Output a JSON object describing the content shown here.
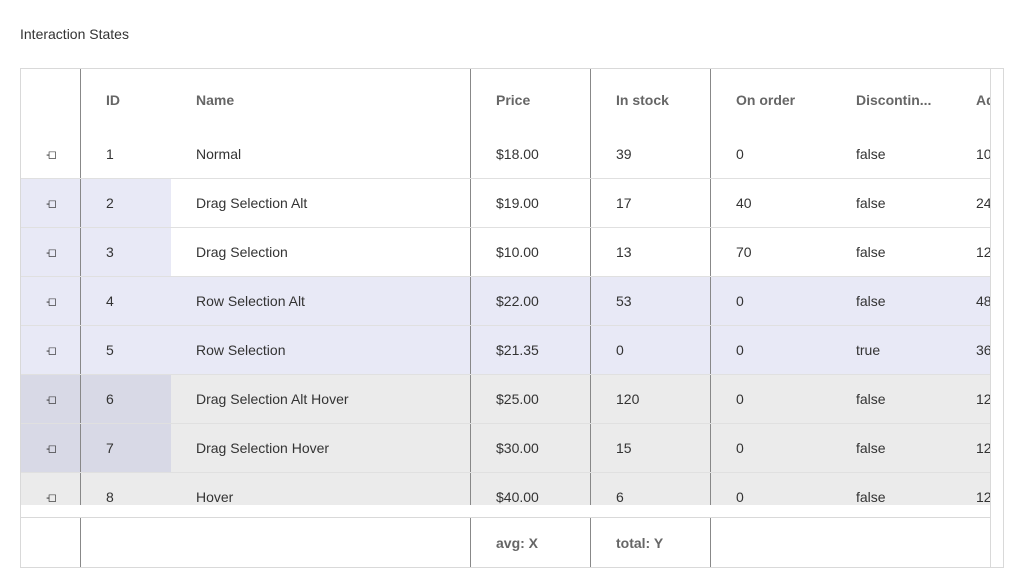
{
  "page_title": "Interaction States",
  "columns": {
    "id": "ID",
    "name": "Name",
    "price": "Price",
    "in_stock": "In stock",
    "on_order": "On order",
    "discontinued": "Discontin...",
    "added": "Ad"
  },
  "rows": [
    {
      "id": "1",
      "name": "Normal",
      "price": "$18.00",
      "in_stock": "39",
      "on_order": "0",
      "discontinued": "false",
      "added": "10"
    },
    {
      "id": "2",
      "name": "Drag Selection Alt",
      "price": "$19.00",
      "in_stock": "17",
      "on_order": "40",
      "discontinued": "false",
      "added": "24"
    },
    {
      "id": "3",
      "name": "Drag Selection",
      "price": "$10.00",
      "in_stock": "13",
      "on_order": "70",
      "discontinued": "false",
      "added": "12"
    },
    {
      "id": "4",
      "name": "Row Selection Alt",
      "price": "$22.00",
      "in_stock": "53",
      "on_order": "0",
      "discontinued": "false",
      "added": "48"
    },
    {
      "id": "5",
      "name": "Row Selection",
      "price": "$21.35",
      "in_stock": "0",
      "on_order": "0",
      "discontinued": "true",
      "added": "36"
    },
    {
      "id": "6",
      "name": "Drag Selection Alt Hover",
      "price": "$25.00",
      "in_stock": "120",
      "on_order": "0",
      "discontinued": "false",
      "added": "12"
    },
    {
      "id": "7",
      "name": "Drag Selection Hover",
      "price": "$30.00",
      "in_stock": "15",
      "on_order": "0",
      "discontinued": "false",
      "added": "12"
    },
    {
      "id": "8",
      "name": "Hover",
      "price": "$40.00",
      "in_stock": "6",
      "on_order": "0",
      "discontinued": "false",
      "added": "12"
    }
  ],
  "footer": {
    "price": "avg: X",
    "in_stock": "total: Y"
  },
  "pin_icon": "pin-icon",
  "colors": {
    "drag_selection": "#e8e9f6",
    "row_selection": "#e8e9f6",
    "hover": "#ebebeb",
    "drag_selection_hover": "#d8d9e6"
  }
}
